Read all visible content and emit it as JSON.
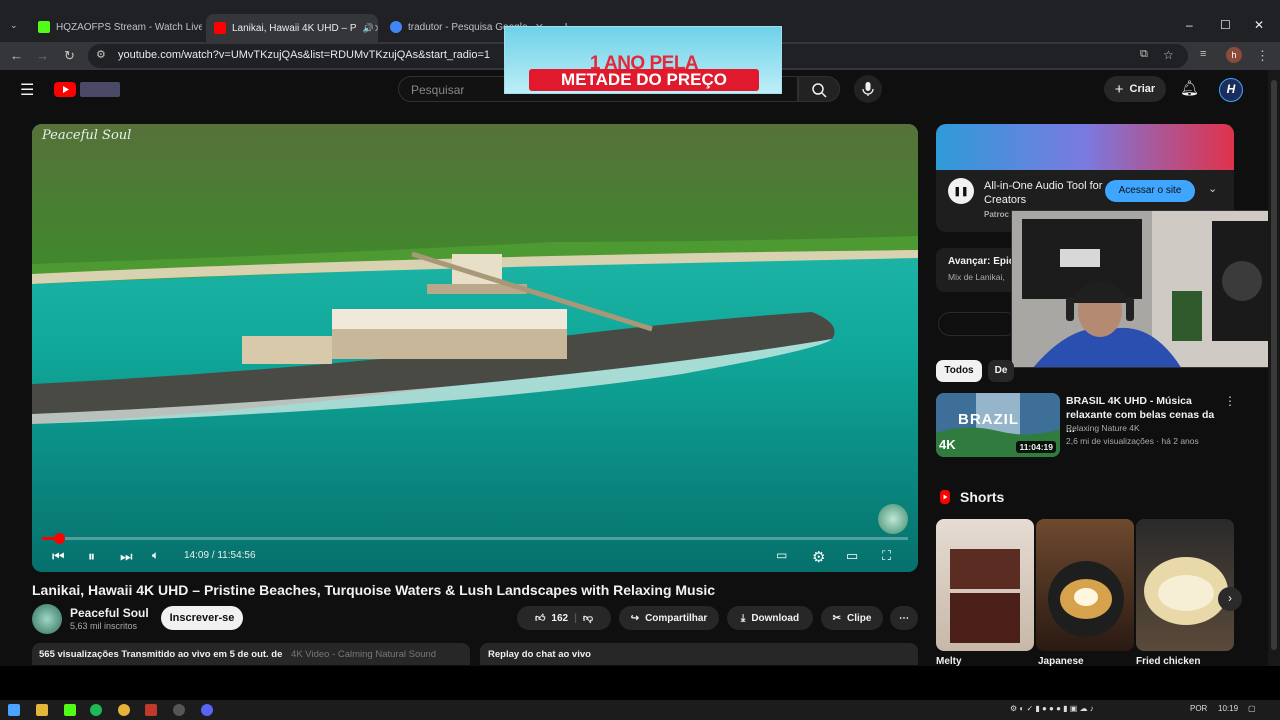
{
  "browser": {
    "tabs": [
      {
        "title": "HQZAOFPS Stream - Watch Live",
        "close": "✕",
        "favicon_color": "#53fc18"
      },
      {
        "title": "Lanikai, Hawaii 4K UHD – P",
        "close": "✕",
        "favicon_color": "#ff0000"
      },
      {
        "title": "tradutor - Pesquisa Google",
        "close": "✕",
        "favicon_color": "#4285f4"
      }
    ],
    "new_tab": "+",
    "url": "youtube.com/watch?v=UMvTKzujQAs&list=RDUMvTKzujQAs&start_radio=1",
    "profile_initial": "h"
  },
  "overlay_ad": {
    "line1": "1 ANO PELA",
    "line2": "METADE DO PREÇO"
  },
  "youtube": {
    "search_placeholder": "Pesquisar",
    "create_label": "Criar",
    "avatar_letter": "H"
  },
  "video": {
    "watermark": "Peaceful Soul",
    "current_time": "14:09",
    "duration": "11:54:56",
    "time_display": "14:09 / 11:54:56",
    "progress_fraction": 0.02,
    "title": "Lanikai, Hawaii 4K UHD – Pristine Beaches, Turquoise Waters & Lush Landscapes with Relaxing Music",
    "channel": "Peaceful Soul",
    "subscribers": "5,63 mil inscritos",
    "subscribe_label": "Inscrever-se",
    "likes": "162",
    "share_label": "Compartilhar",
    "download_label": "Download",
    "clip_label": "Clipe",
    "description_stats": "565 visualizações  Transmitido ao vivo em 5 de out. de",
    "description_tags": "4K Video - Calming Natural Sound",
    "chat_replay_label": "Replay do chat ao vivo"
  },
  "sidebar": {
    "ad": {
      "title": "All-in-One Audio Tool for Creators",
      "sponsored": "Patroc",
      "cta": "Acessar o site"
    },
    "mix": {
      "label": "Avançar: Epic",
      "sub": "Mix de Lanikai, "
    },
    "chips": [
      "Todos",
      "De"
    ],
    "recommendation": {
      "title": "BRASIL 4K UHD - Música relaxante com belas cenas da ...",
      "channel": "Relaxing Nature 4K",
      "meta": "2,6 mi de visualizações · há 2 anos",
      "duration": "11:04:19",
      "thumb_text": "BRAZIL",
      "thumb_badge": "4K"
    },
    "shorts_heading": "Shorts",
    "shorts": [
      {
        "title": "Melty"
      },
      {
        "title": "Japanese"
      },
      {
        "title": "Fried chicken"
      }
    ]
  },
  "taskbar": {
    "language": "POR",
    "clock": "10:19"
  }
}
